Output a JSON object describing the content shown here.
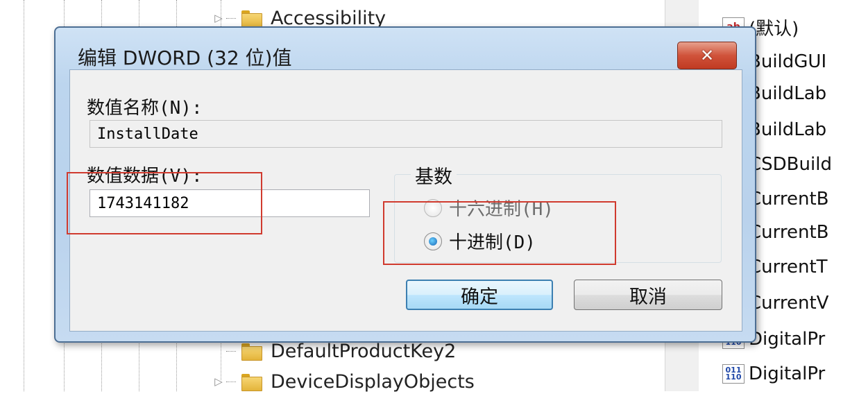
{
  "tree": {
    "items": [
      {
        "label": "Accessibility",
        "expandable": true
      },
      {
        "label": "DefaultProductKey2",
        "expandable": false
      },
      {
        "label": "DeviceDisplayObjects",
        "expandable": true
      }
    ]
  },
  "values": {
    "rows": [
      {
        "icon": "string-value-icon",
        "name": "(默认)"
      },
      {
        "icon": "string-value-icon",
        "name": "BuildGUI"
      },
      {
        "icon": "string-value-icon",
        "name": "BuildLab"
      },
      {
        "icon": "string-value-icon",
        "name": "BuildLab"
      },
      {
        "icon": "string-value-icon",
        "name": "CSDBuild"
      },
      {
        "icon": "string-value-icon",
        "name": "CurrentB"
      },
      {
        "icon": "string-value-icon",
        "name": "CurrentB"
      },
      {
        "icon": "string-value-icon",
        "name": "CurrentT"
      },
      {
        "icon": "string-value-icon",
        "name": "CurrentV"
      },
      {
        "icon": "binary-value-icon",
        "name": "DigitalPr"
      },
      {
        "icon": "binary-value-icon",
        "name": "DigitalPr"
      }
    ],
    "icon_text_string": "ab",
    "icon_text_binary": "011\n110"
  },
  "dialog": {
    "title": "编辑 DWORD (32 位)值",
    "close_glyph": "✕",
    "value_name_label": "数值名称(N):",
    "value_name": "InstallDate",
    "value_data_label": "数值数据(V):",
    "value_data": "1743141182",
    "base_legend": "基数",
    "radio_hex_label": "十六进制(H)",
    "radio_dec_label": "十进制(D)",
    "selected_base": "decimal",
    "ok_label": "确定",
    "cancel_label": "取消"
  },
  "colors": {
    "highlight": "#d03a2e",
    "close_button": "#c8472f",
    "dialog_frame": "#b9d2ec"
  }
}
